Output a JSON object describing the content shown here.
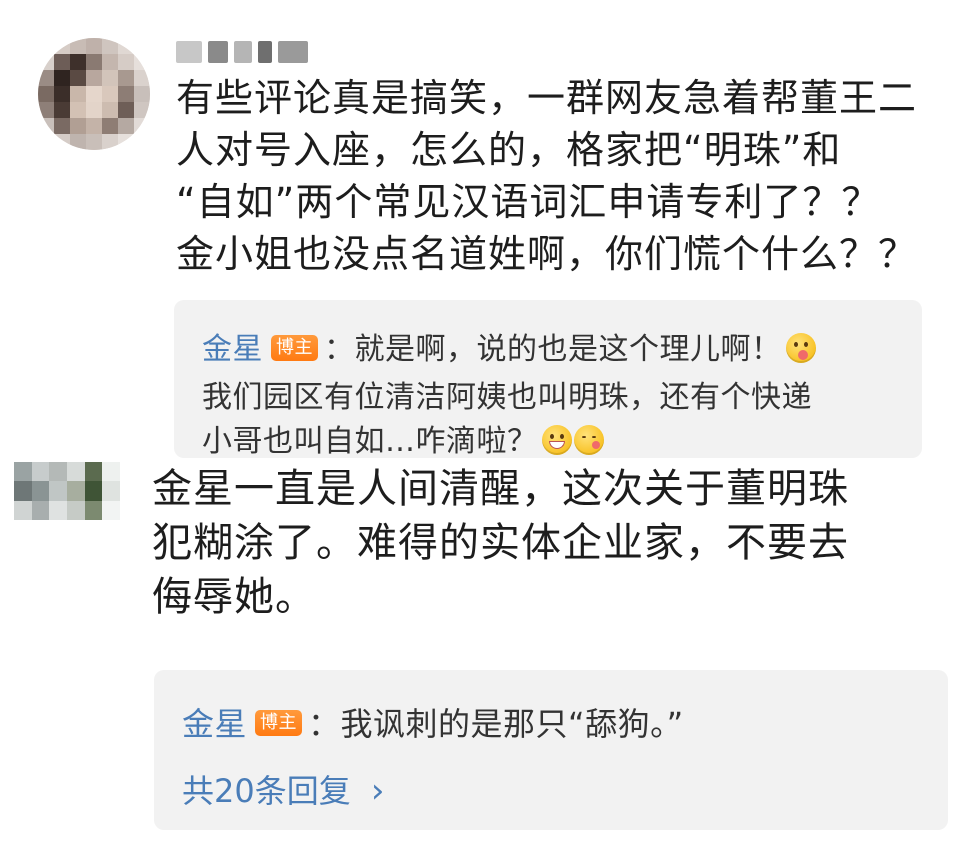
{
  "comment1": {
    "lines": [
      "有些评论真是搞笑，一群网友急着帮董王二",
      "人对号入座，怎么的，格家把“明珠”和",
      "“自如”两个常见汉语词汇申请专利了？？",
      "金小姐也没点名道姓啊，你们慌个什么？？"
    ],
    "reply": {
      "author": "金星",
      "badge": "博主",
      "line1": "：就是啊，说的也是这个理儿啊！",
      "line2": "我们园区有位清洁阿姨也叫明珠，还有个快递",
      "line3": "小哥也叫自如…咋滴啦？"
    }
  },
  "comment2": {
    "lines": [
      "金星一直是人间清醒，这次关于董明珠",
      "犯糊涂了。难得的实体企业家，不要去",
      "侮辱她。"
    ],
    "reply": {
      "author": "金星",
      "badge": "博主",
      "text": "：我讽刺的是那只“舔狗。”",
      "more": "共20条回复",
      "more_chevron": "›"
    }
  },
  "icons": [
    "tongue-out-emoji",
    "grin-emoji",
    "kiss-emoji",
    "chevron-right-icon"
  ],
  "colors": {
    "author": "#4a7db8",
    "badge": "#ff8a20",
    "reply_bg": "#f2f2f2"
  }
}
